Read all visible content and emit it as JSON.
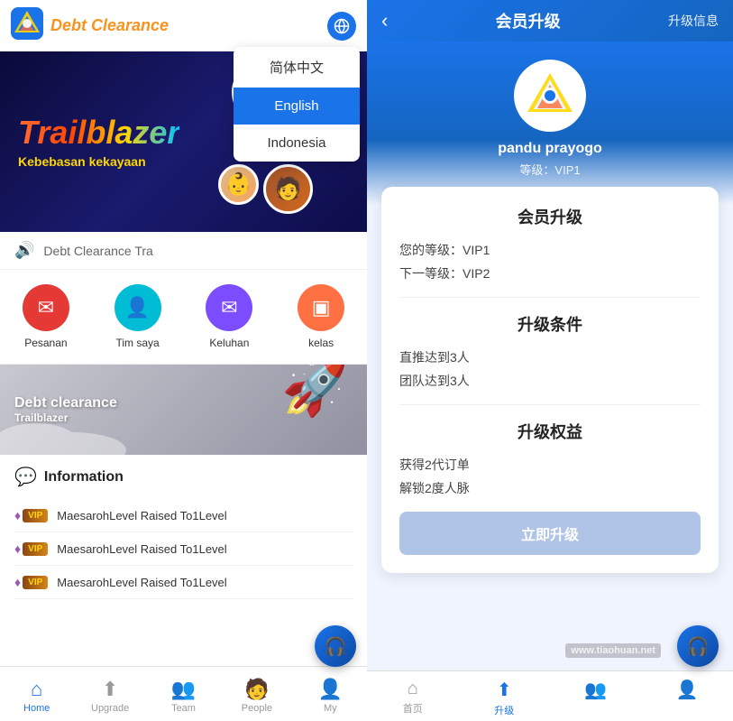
{
  "left": {
    "header": {
      "title": "Debt Clearance",
      "globe_label": "🌐"
    },
    "language_dropdown": {
      "items": [
        {
          "label": "简体中文",
          "active": false
        },
        {
          "label": "English",
          "active": true
        },
        {
          "label": "Indonesia",
          "active": false
        }
      ]
    },
    "banner": {
      "title": "Trailblazer",
      "subtitle": "Kebebasan kekayaan"
    },
    "audio_bar": {
      "text": "Debt Clearance Tra"
    },
    "actions": [
      {
        "label": "Pesanan",
        "icon": "✉",
        "color_class": "icon-red"
      },
      {
        "label": "Tim saya",
        "icon": "👤",
        "color_class": "icon-teal"
      },
      {
        "label": "Keluhan",
        "icon": "✉",
        "color_class": "icon-purple"
      },
      {
        "label": "kelas",
        "icon": "▣",
        "color_class": "icon-orange"
      }
    ],
    "promo": {
      "title": "Debt clearance",
      "subtitle": "Trailblazer"
    },
    "information": {
      "title": "Information",
      "items": [
        {
          "text": "MaesarohLevel Raised To1Level"
        },
        {
          "text": "MaesarohLevel Raised To1Level"
        },
        {
          "text": "MaesarohLevel Raised To1Level"
        }
      ]
    },
    "bottom_nav": [
      {
        "label": "Home",
        "icon": "⌂",
        "active": true
      },
      {
        "label": "Upgrade",
        "icon": "↑",
        "active": false
      },
      {
        "label": "Team",
        "icon": "👥",
        "active": false
      },
      {
        "label": "People",
        "icon": "🧑",
        "active": false
      },
      {
        "label": "My",
        "icon": "👤",
        "active": false
      }
    ]
  },
  "right": {
    "header": {
      "back_icon": "‹",
      "title": "会员升级",
      "info_link": "升级信息"
    },
    "profile": {
      "name": "pandu prayogo",
      "level": "等级：VIP1"
    },
    "upgrade_card": {
      "section_title": "会员升级",
      "current_level_label": "您的等级：VIP1",
      "next_level_label": "下一等级：VIP2",
      "conditions_title": "升级条件",
      "condition1": "直推达到3人",
      "condition2": "团队达到3人",
      "benefits_title": "升级权益",
      "benefit1": "获得2代订单",
      "benefit2": "解锁2度人脉",
      "upgrade_btn_label": "立即升级"
    },
    "bottom_nav": [
      {
        "label": "首页",
        "icon": "⌂",
        "active": false
      },
      {
        "label": "升级",
        "icon": "↑",
        "active": true
      },
      {
        "label": "",
        "icon": "👥",
        "active": false
      },
      {
        "label": "",
        "icon": "",
        "active": false
      }
    ],
    "watermark": "www.tiaohuan.net"
  }
}
